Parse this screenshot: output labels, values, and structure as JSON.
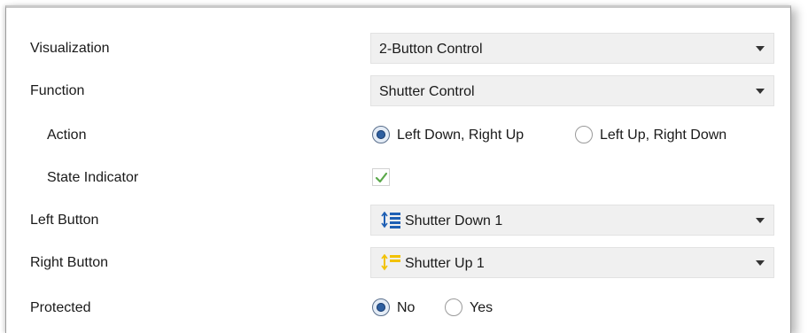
{
  "settings": {
    "visualization": {
      "label": "Visualization",
      "value": "2-Button Control"
    },
    "function": {
      "label": "Function",
      "value": "Shutter Control"
    },
    "action": {
      "label": "Action",
      "options": [
        {
          "label": "Left Down, Right Up",
          "selected": true
        },
        {
          "label": "Left Up, Right Down",
          "selected": false
        }
      ]
    },
    "state_indicator": {
      "label": "State Indicator",
      "checked": true
    },
    "left_button": {
      "label": "Left Button",
      "value": "Shutter Down 1",
      "icon": "shutter-down-icon"
    },
    "right_button": {
      "label": "Right Button",
      "value": "Shutter Up 1",
      "icon": "shutter-up-icon"
    },
    "protected": {
      "label": "Protected",
      "options": [
        {
          "label": "No",
          "selected": true
        },
        {
          "label": "Yes",
          "selected": false
        }
      ]
    }
  },
  "colors": {
    "accent": "#2e5fa0",
    "check": "#5aa84a",
    "shutter_down_icon": "#1e5fb4",
    "shutter_up_icon": "#f2c200",
    "field_bg": "#f0f0f0"
  }
}
